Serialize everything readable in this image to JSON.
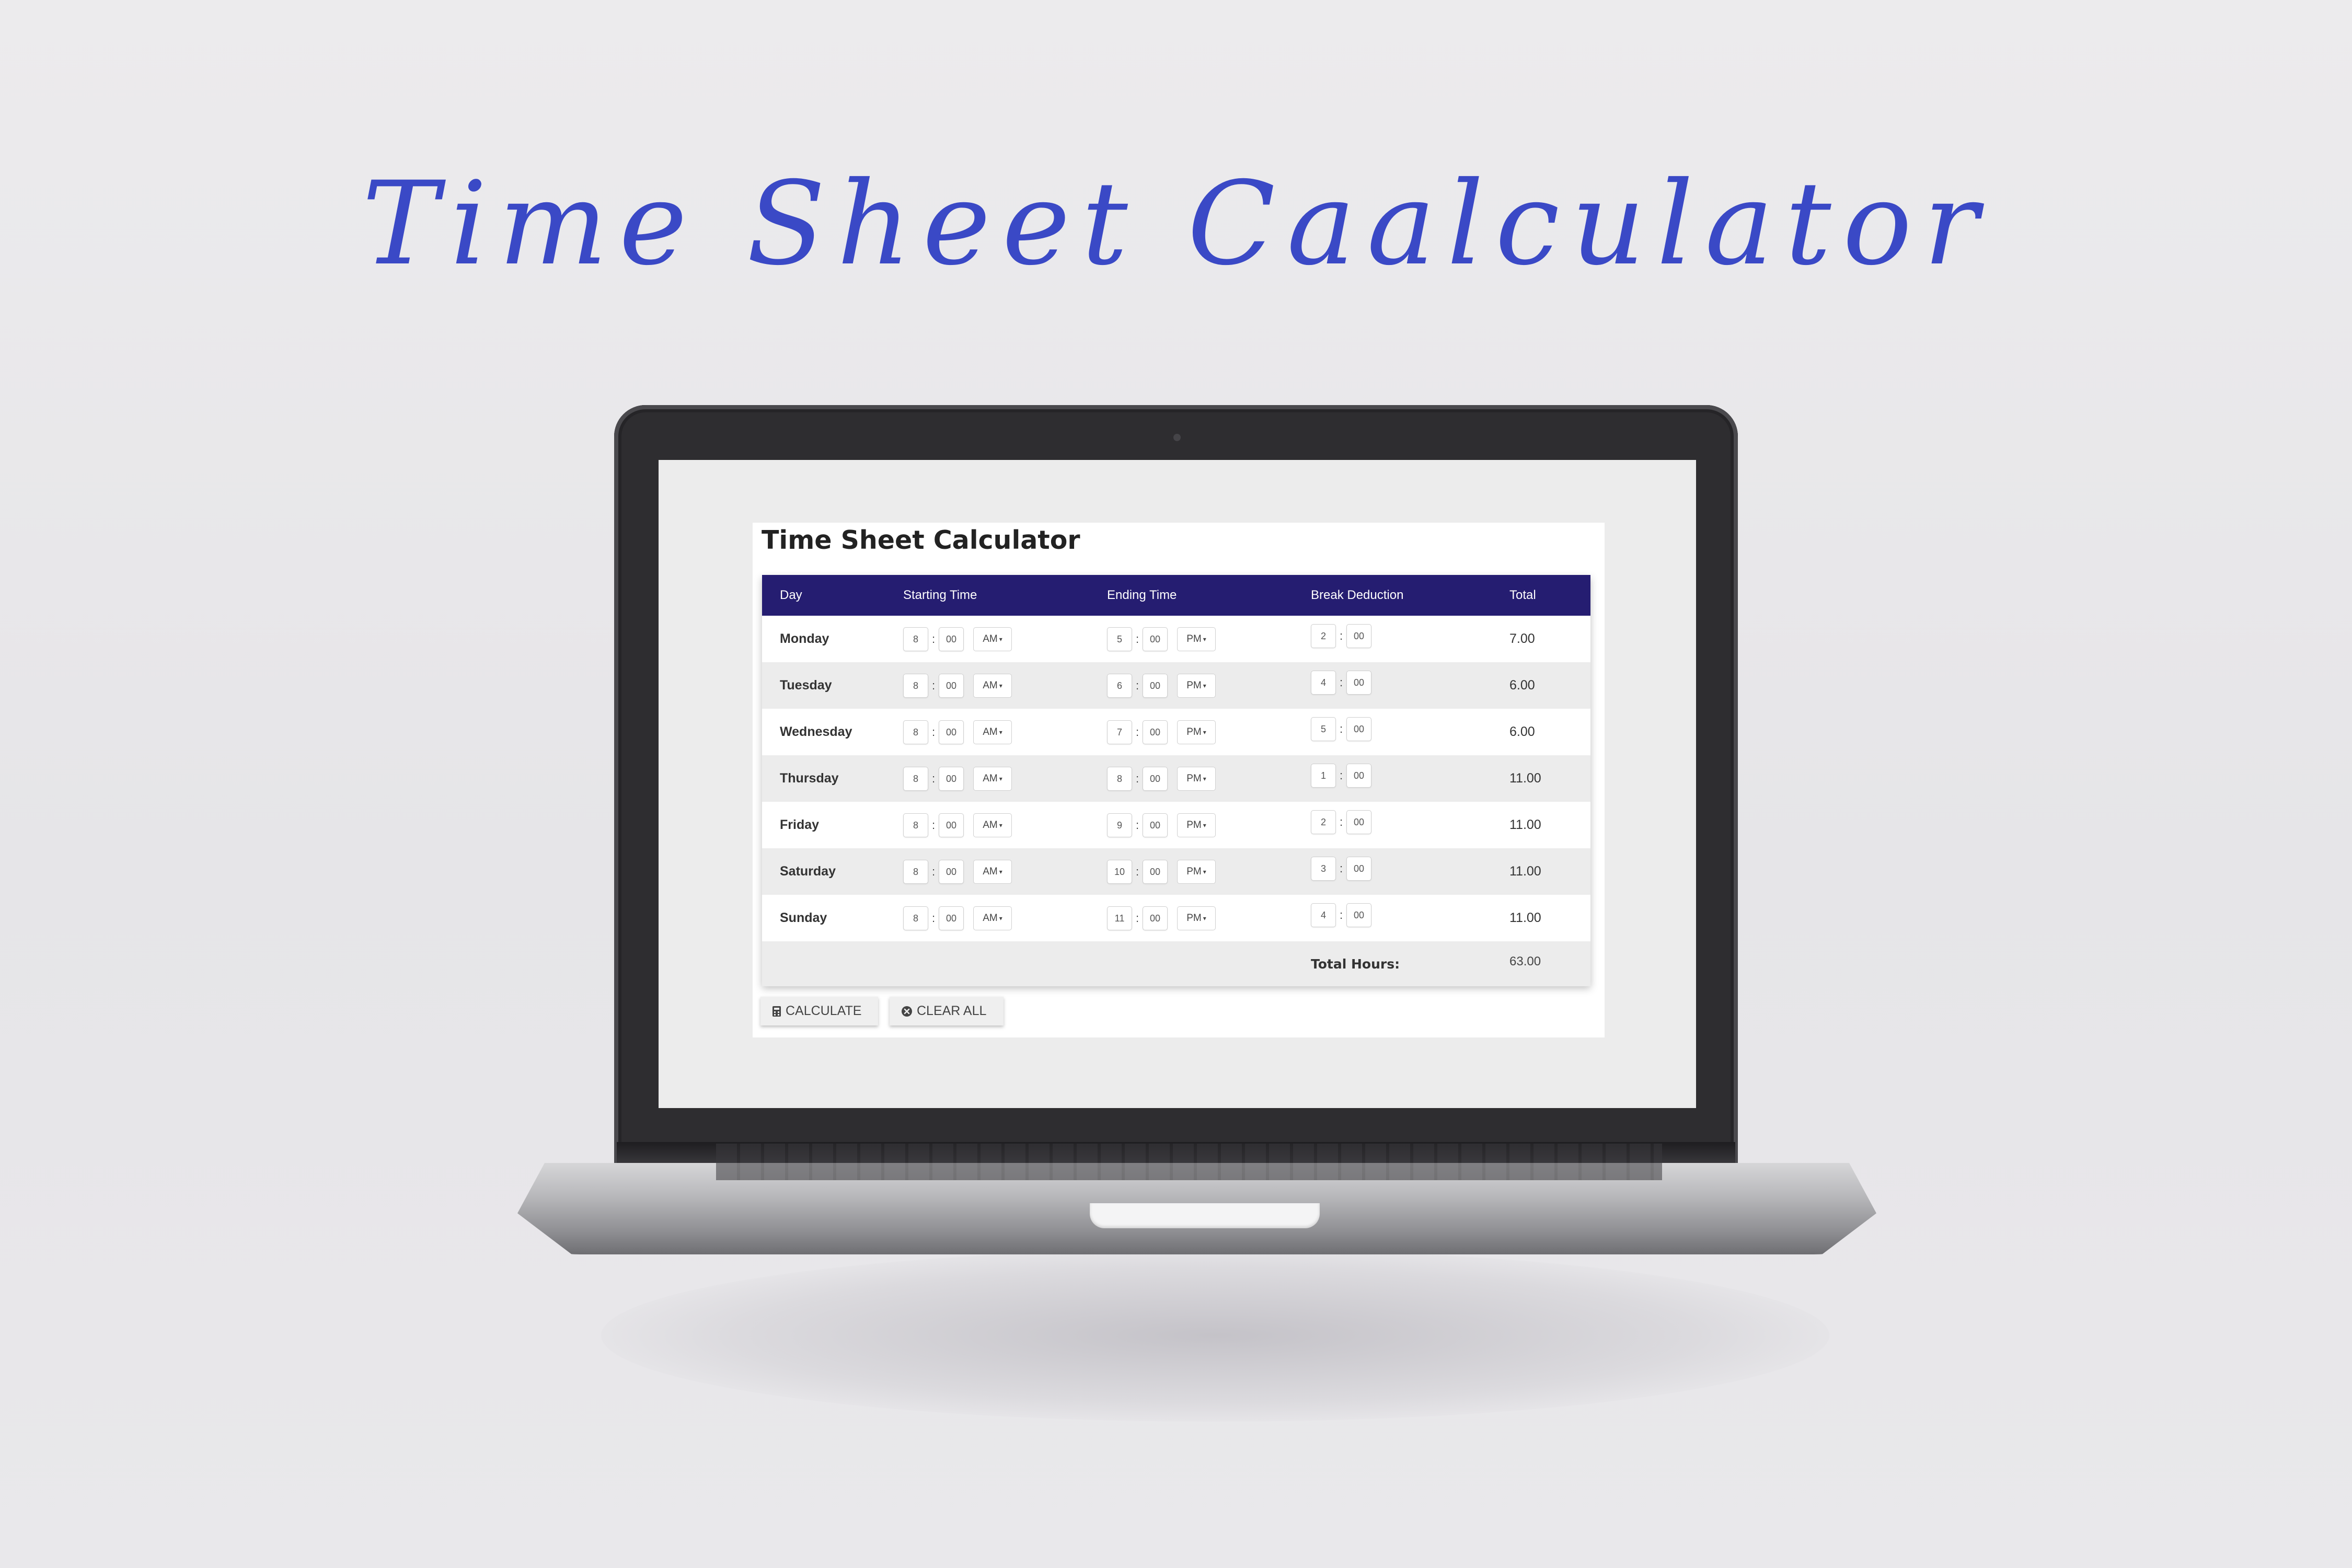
{
  "hero_title": "Time Sheet Caalculator",
  "app": {
    "title": "Time Sheet Calculator",
    "columns": [
      "Day",
      "Starting Time",
      "Ending Time",
      "Break Deduction",
      "Total"
    ],
    "rows": [
      {
        "day": "Monday",
        "start_h": "8",
        "start_m": "00",
        "start_ampm": "AM",
        "end_h": "5",
        "end_m": "00",
        "end_ampm": "PM",
        "brk_h": "2",
        "brk_m": "00",
        "total": "7.00"
      },
      {
        "day": "Tuesday",
        "start_h": "8",
        "start_m": "00",
        "start_ampm": "AM",
        "end_h": "6",
        "end_m": "00",
        "end_ampm": "PM",
        "brk_h": "4",
        "brk_m": "00",
        "total": "6.00"
      },
      {
        "day": "Wednesday",
        "start_h": "8",
        "start_m": "00",
        "start_ampm": "AM",
        "end_h": "7",
        "end_m": "00",
        "end_ampm": "PM",
        "brk_h": "5",
        "brk_m": "00",
        "total": "6.00"
      },
      {
        "day": "Thursday",
        "start_h": "8",
        "start_m": "00",
        "start_ampm": "AM",
        "end_h": "8",
        "end_m": "00",
        "end_ampm": "PM",
        "brk_h": "1",
        "brk_m": "00",
        "total": "11.00"
      },
      {
        "day": "Friday",
        "start_h": "8",
        "start_m": "00",
        "start_ampm": "AM",
        "end_h": "9",
        "end_m": "00",
        "end_ampm": "PM",
        "brk_h": "2",
        "brk_m": "00",
        "total": "11.00"
      },
      {
        "day": "Saturday",
        "start_h": "8",
        "start_m": "00",
        "start_ampm": "AM",
        "end_h": "10",
        "end_m": "00",
        "end_ampm": "PM",
        "brk_h": "3",
        "brk_m": "00",
        "total": "11.00"
      },
      {
        "day": "Sunday",
        "start_h": "8",
        "start_m": "00",
        "start_ampm": "AM",
        "end_h": "11",
        "end_m": "00",
        "end_ampm": "PM",
        "brk_h": "4",
        "brk_m": "00",
        "total": "11.00"
      }
    ],
    "total_label": "Total Hours:",
    "total_value": "63.00",
    "buttons": {
      "calculate": "CALCULATE",
      "clear": "CLEAR ALL"
    },
    "icons": {
      "calculate": "calculator-icon",
      "clear": "close-circle-icon",
      "dropdown": "caret-down-icon"
    },
    "colors": {
      "header_bg": "#251d71",
      "hero_text": "#3a49c6"
    }
  }
}
